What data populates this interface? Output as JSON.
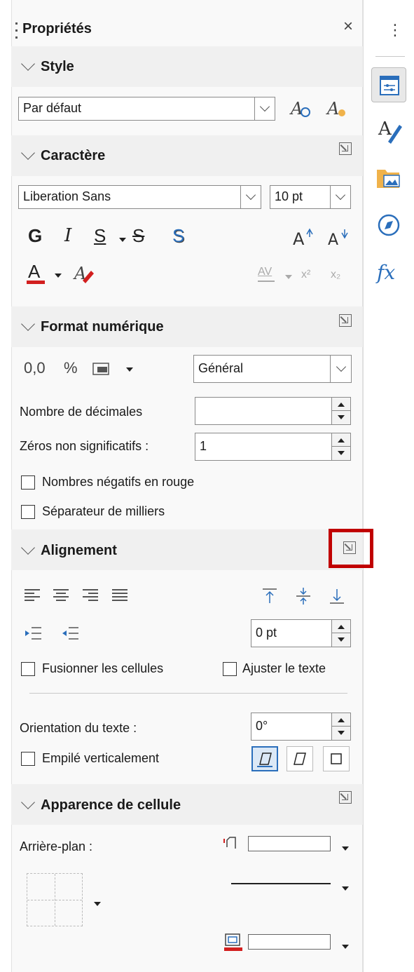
{
  "panel": {
    "title": "Propriétés",
    "close_glyph": "×",
    "menu_glyph": "⋮"
  },
  "style_section": {
    "title": "Style",
    "current_style": "Par défaut"
  },
  "character_section": {
    "title": "Caractère",
    "font_name": "Liberation Sans",
    "font_size": "10 pt",
    "bold": "G",
    "italic": "I",
    "underline": "S",
    "strikethrough": "S",
    "shadow": "S",
    "font_color_letter": "A",
    "increase_size": "A",
    "decrease_size": "A",
    "spacing": "AV",
    "superscript": "x²",
    "subscript": "x₂"
  },
  "number_format_section": {
    "title": "Format numérique",
    "decimal_glyph": "0,0",
    "percent_glyph": "%",
    "format_value": "Général",
    "decimals_label": "Nombre de décimales",
    "decimals_value": "",
    "leading_zeros_label": "Zéros non significatifs :",
    "leading_zeros_value": "1",
    "negative_red_label": "Nombres négatifs en rouge",
    "thousands_sep_label": "Séparateur de milliers"
  },
  "alignment_section": {
    "title": "Alignement",
    "indent_value": "0 pt",
    "merge_cells_label": "Fusionner les cellules",
    "wrap_text_label": "Ajuster le texte",
    "orientation_label": "Orientation du texte :",
    "orientation_value": "0°",
    "vertical_stack_label": "Empilé verticalement"
  },
  "cell_appearance_section": {
    "title": "Apparence de cellule",
    "background_label": "Arrière-plan :"
  },
  "colors": {
    "accent_blue": "#2a6ebb",
    "highlight_red": "#c00000",
    "font_color_red": "#d21f1f"
  }
}
